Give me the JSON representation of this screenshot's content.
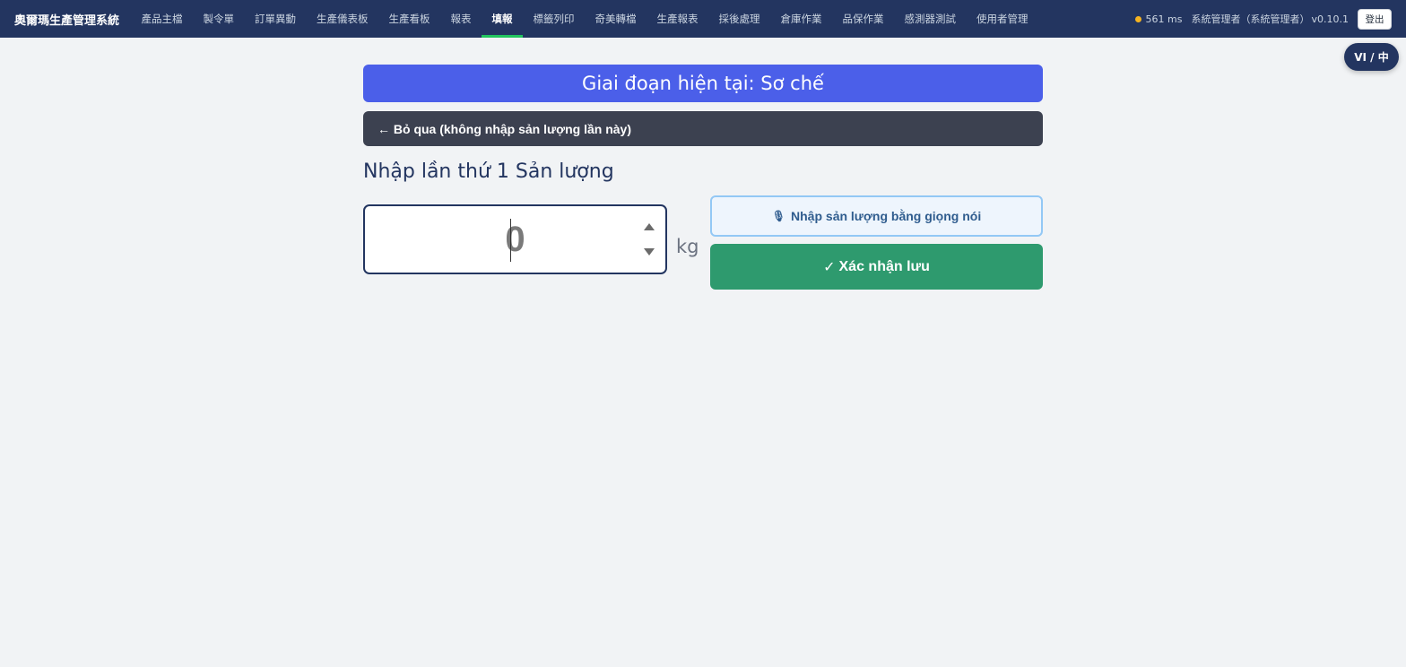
{
  "header": {
    "brand": "奧爾瑪生產管理系統",
    "nav": [
      {
        "label": "產品主檔",
        "active": false
      },
      {
        "label": "製令單",
        "active": false
      },
      {
        "label": "訂單異動",
        "active": false
      },
      {
        "label": "生產儀表板",
        "active": false
      },
      {
        "label": "生產看板",
        "active": false
      },
      {
        "label": "報表",
        "active": false
      },
      {
        "label": "填報",
        "active": true
      },
      {
        "label": "標籤列印",
        "active": false
      },
      {
        "label": "奇美轉檔",
        "active": false
      },
      {
        "label": "生產報表",
        "active": false
      },
      {
        "label": "採後處理",
        "active": false
      },
      {
        "label": "倉庫作業",
        "active": false
      },
      {
        "label": "品保作業",
        "active": false
      },
      {
        "label": "感測器測試",
        "active": false
      },
      {
        "label": "使用者管理",
        "active": false
      }
    ],
    "latency": "561 ms",
    "latency_color": "#f5b321",
    "user": "系統管理者（系統管理者）",
    "version": "v0.10.1",
    "logout_label": "登出"
  },
  "lang_toggle": "VI / 中",
  "stage_banner": "Giai đoạn hiện tại: Sơ chế",
  "skip_button": "← Bỏ qua (không nhập sản lượng lần này)",
  "entry_title": "Nhập lần thứ 1 Sản lượng",
  "quantity": {
    "value": "0",
    "unit": "kg"
  },
  "voice_button": {
    "icon": "microphone-icon",
    "glyph": "🎙",
    "label": "Nhập sản lượng bằng giọng nói"
  },
  "confirm_button": {
    "icon": "checkmark-icon",
    "glyph": "✓",
    "label": "Xác nhận lưu"
  },
  "colors": {
    "topbar": "#233560",
    "banner": "#4b5fe9",
    "skip": "#3c4150",
    "confirm": "#2e9a6e",
    "voice_bg": "#eef5fd",
    "active_underline": "#22c55e"
  }
}
